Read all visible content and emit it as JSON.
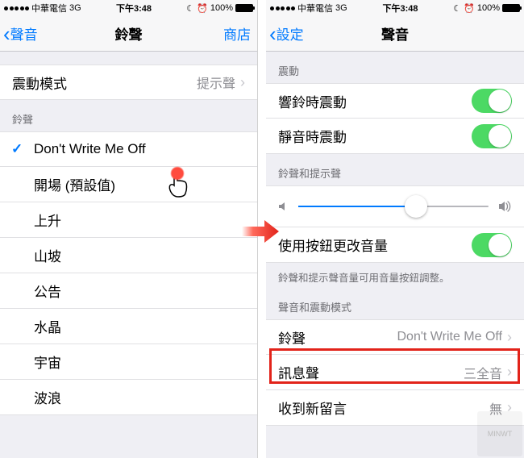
{
  "status": {
    "carrier": "中華電信",
    "network": "3G",
    "time_left": "下午3:48",
    "time_right": "下午3:48",
    "battery": "100%",
    "alarm_icon": "⦿",
    "batt_icon": "100%"
  },
  "left": {
    "back": "聲音",
    "title": "鈴聲",
    "right": "商店",
    "vibration_row": {
      "label": "震動模式",
      "detail": "提示聲"
    },
    "section": "鈴聲",
    "selected": "Don't Write Me Off",
    "items": [
      "開場 (預設值)",
      "上升",
      "山坡",
      "公告",
      "水晶",
      "宇宙",
      "波浪"
    ]
  },
  "right": {
    "back": "設定",
    "title": "聲音",
    "section_vibrate": "震動",
    "vibrate_ring": "響鈴時震動",
    "vibrate_silent": "靜音時震動",
    "section_ringer": "鈴聲和提示聲",
    "change_with_buttons": "使用按鈕更改音量",
    "footnote": "鈴聲和提示聲音量可用音量按鈕調整。",
    "section_patterns": "聲音和震動模式",
    "rows": {
      "ringtone": {
        "label": "鈴聲",
        "detail": "Don't Write Me Off"
      },
      "text_tone": {
        "label": "訊息聲",
        "detail": "三全音"
      },
      "voicemail": {
        "label": "收到新留言",
        "detail": "無"
      }
    },
    "slider_value_pct": 62
  },
  "watermark": "MINWT"
}
